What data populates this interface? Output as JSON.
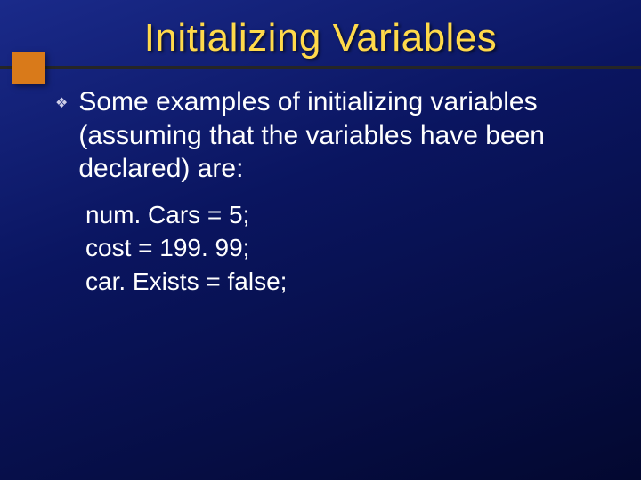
{
  "title": "Initializing Variables",
  "bullet": "Some examples of initializing variables (assuming that the variables have been declared) are:",
  "examples": [
    "num. Cars = 5;",
    "cost = 199. 99;",
    "car. Exists = false;"
  ]
}
